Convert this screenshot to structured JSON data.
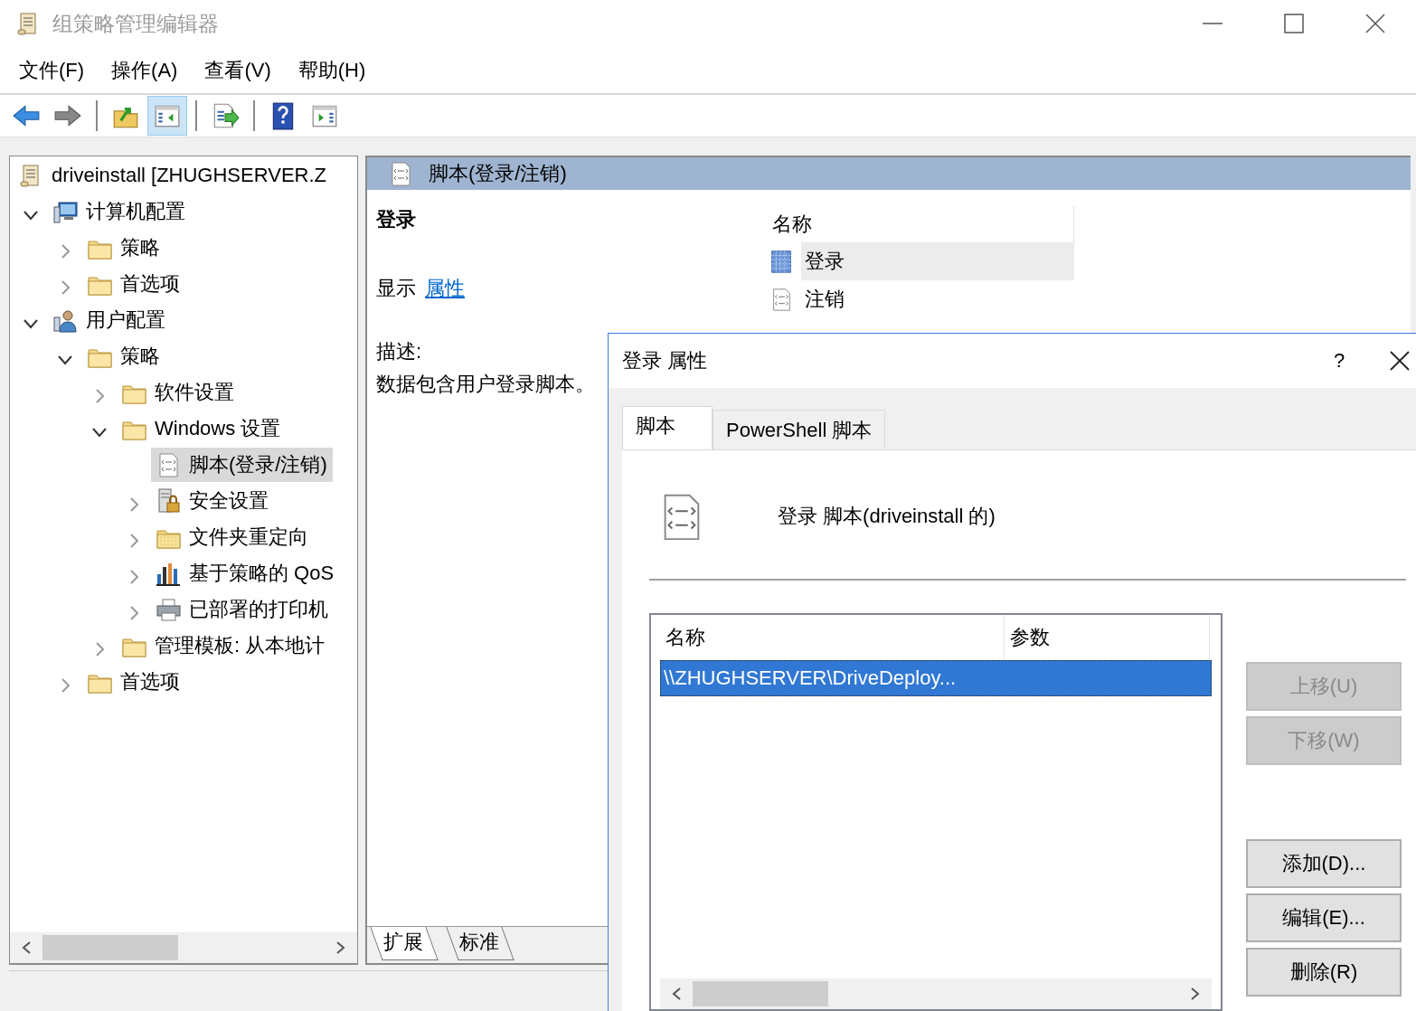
{
  "window": {
    "title": "组策略管理编辑器"
  },
  "menu": [
    "文件(F)",
    "操作(A)",
    "查看(V)",
    "帮助(H)"
  ],
  "toolbar": [
    [
      {
        "kind": "back",
        "pressed": false
      },
      {
        "kind": "forward",
        "pressed": false
      }
    ],
    [
      {
        "kind": "up",
        "pressed": false
      },
      {
        "kind": "tree",
        "pressed": true
      }
    ],
    [
      {
        "kind": "export",
        "pressed": false
      }
    ],
    [
      {
        "kind": "help",
        "pressed": false
      },
      {
        "kind": "action",
        "pressed": false
      }
    ]
  ],
  "tree": {
    "items": [
      {
        "label": "driveinstall [ZHUGHSERVER.Z",
        "kind": "scroll",
        "selected": false,
        "children": [
          {
            "label": "计算机配置",
            "kind": "computer",
            "expanded": true,
            "selected": false,
            "children": [
              {
                "label": "策略",
                "kind": "folder",
                "expanded": false,
                "selected": false
              },
              {
                "label": "首选项",
                "kind": "folder",
                "expanded": false,
                "selected": false
              }
            ]
          },
          {
            "label": "用户配置",
            "kind": "user",
            "expanded": true,
            "selected": false,
            "children": [
              {
                "label": "策略",
                "kind": "folder",
                "expanded": true,
                "selected": false,
                "children": [
                  {
                    "label": "软件设置",
                    "kind": "folder",
                    "expanded": false,
                    "selected": false
                  },
                  {
                    "label": "Windows 设置",
                    "kind": "folder",
                    "expanded": true,
                    "selected": false,
                    "children": [
                      {
                        "label": "脚本(登录/注销)",
                        "kind": "script",
                        "selected": true
                      },
                      {
                        "label": "安全设置",
                        "kind": "security",
                        "expanded": false,
                        "selected": false
                      },
                      {
                        "label": "文件夹重定向",
                        "kind": "redirect",
                        "expanded": false,
                        "selected": false
                      },
                      {
                        "label": "基于策略的 QoS",
                        "kind": "qos",
                        "expanded": false,
                        "selected": false
                      },
                      {
                        "label": "已部署的打印机",
                        "kind": "printer",
                        "expanded": false,
                        "selected": false
                      }
                    ]
                  },
                  {
                    "label": "管理模板: 从本地计",
                    "kind": "folder",
                    "expanded": false,
                    "selected": false
                  }
                ]
              },
              {
                "label": "首选项",
                "kind": "folder",
                "expanded": false,
                "selected": false
              }
            ]
          }
        ]
      }
    ]
  },
  "detail": {
    "title": "脚本(登录/注销)",
    "heading": "登录",
    "show_label": "显示",
    "link": "属性",
    "description_label": "描述:",
    "description": "数据包含用户登录脚本。",
    "list": {
      "column": "名称",
      "items": [
        {
          "label": "登录",
          "kind": "logon",
          "selected": true
        },
        {
          "label": "注销",
          "kind": "script",
          "selected": false
        }
      ]
    },
    "view_tabs": [
      {
        "label": "扩展",
        "selected": true
      },
      {
        "label": "标准",
        "selected": false
      }
    ]
  },
  "dialog": {
    "title": "登录 属性",
    "help": "?",
    "tabs": [
      {
        "label": "脚本",
        "selected": true
      },
      {
        "label": "PowerShell 脚本",
        "selected": false
      }
    ],
    "heading": "登录 脚本(driveinstall 的)",
    "columns": [
      "名称",
      "参数"
    ],
    "rows": [
      {
        "name": "\\\\ZHUGHSERVER\\DriveDeploy...",
        "selected": true
      }
    ],
    "buttons": [
      {
        "label": "上移(U)",
        "disabled": true
      },
      {
        "label": "下移(W)",
        "disabled": true
      },
      {
        "label": "添加(D)...",
        "disabled": false
      },
      {
        "label": "编辑(E)...",
        "disabled": false
      },
      {
        "label": "删除(R)",
        "disabled": false
      }
    ]
  }
}
